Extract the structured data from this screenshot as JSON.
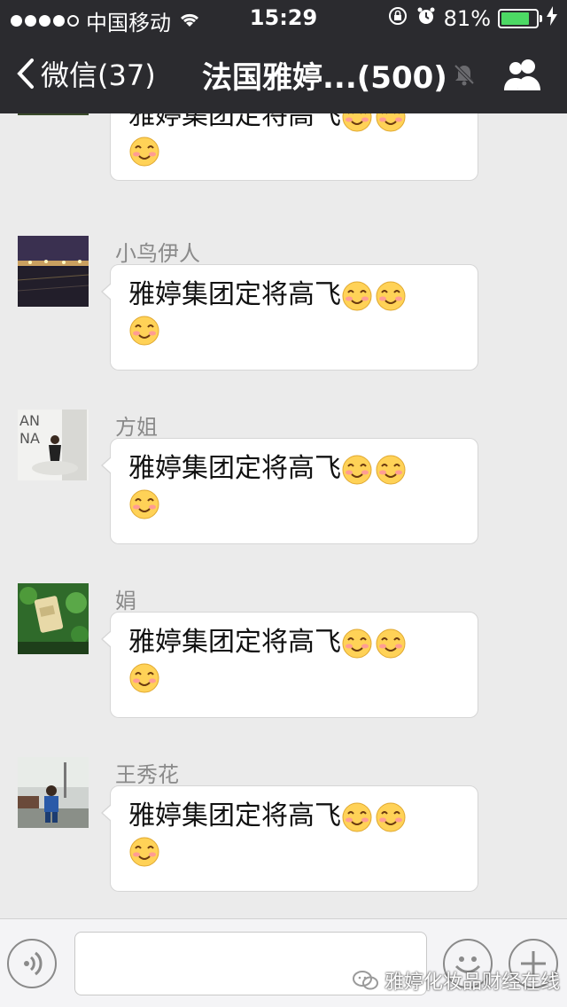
{
  "status_bar": {
    "carrier": "中国移动",
    "time": "15:29",
    "battery": "81%",
    "battery_level": 0.81,
    "signal_bars_filled": 4,
    "signal_bars_total": 5
  },
  "nav": {
    "back_label": "微信(37)",
    "title": "法国雅婷...(500)"
  },
  "messages": [
    {
      "sender": "",
      "text": "雅婷集团定将高飞",
      "emoji_count": 3,
      "avatar": "flowers-avatar"
    },
    {
      "sender": "小鸟伊人",
      "text": "雅婷集团定将高飞",
      "emoji_count": 3,
      "avatar": "city-night-avatar"
    },
    {
      "sender": "方姐",
      "text": "雅婷集团定将高飞",
      "emoji_count": 3,
      "avatar": "anna-photo-avatar"
    },
    {
      "sender": "娟",
      "text": "雅婷集团定将高飞",
      "emoji_count": 3,
      "avatar": "product-avatar"
    },
    {
      "sender": "王秀花",
      "text": "雅婷集团定将高飞",
      "emoji_count": 3,
      "avatar": "child-photo-avatar"
    }
  ],
  "input_bar": {
    "placeholder": "",
    "watermark": "雅婷化妆品财经在线"
  },
  "colors": {
    "header_bg": "#2b2b2f",
    "chat_bg": "#ebebeb",
    "bubble_bg": "#ffffff",
    "battery_green": "#4cd964",
    "emoji_face": "#ffd257",
    "emoji_blush": "#ff8fa3"
  }
}
